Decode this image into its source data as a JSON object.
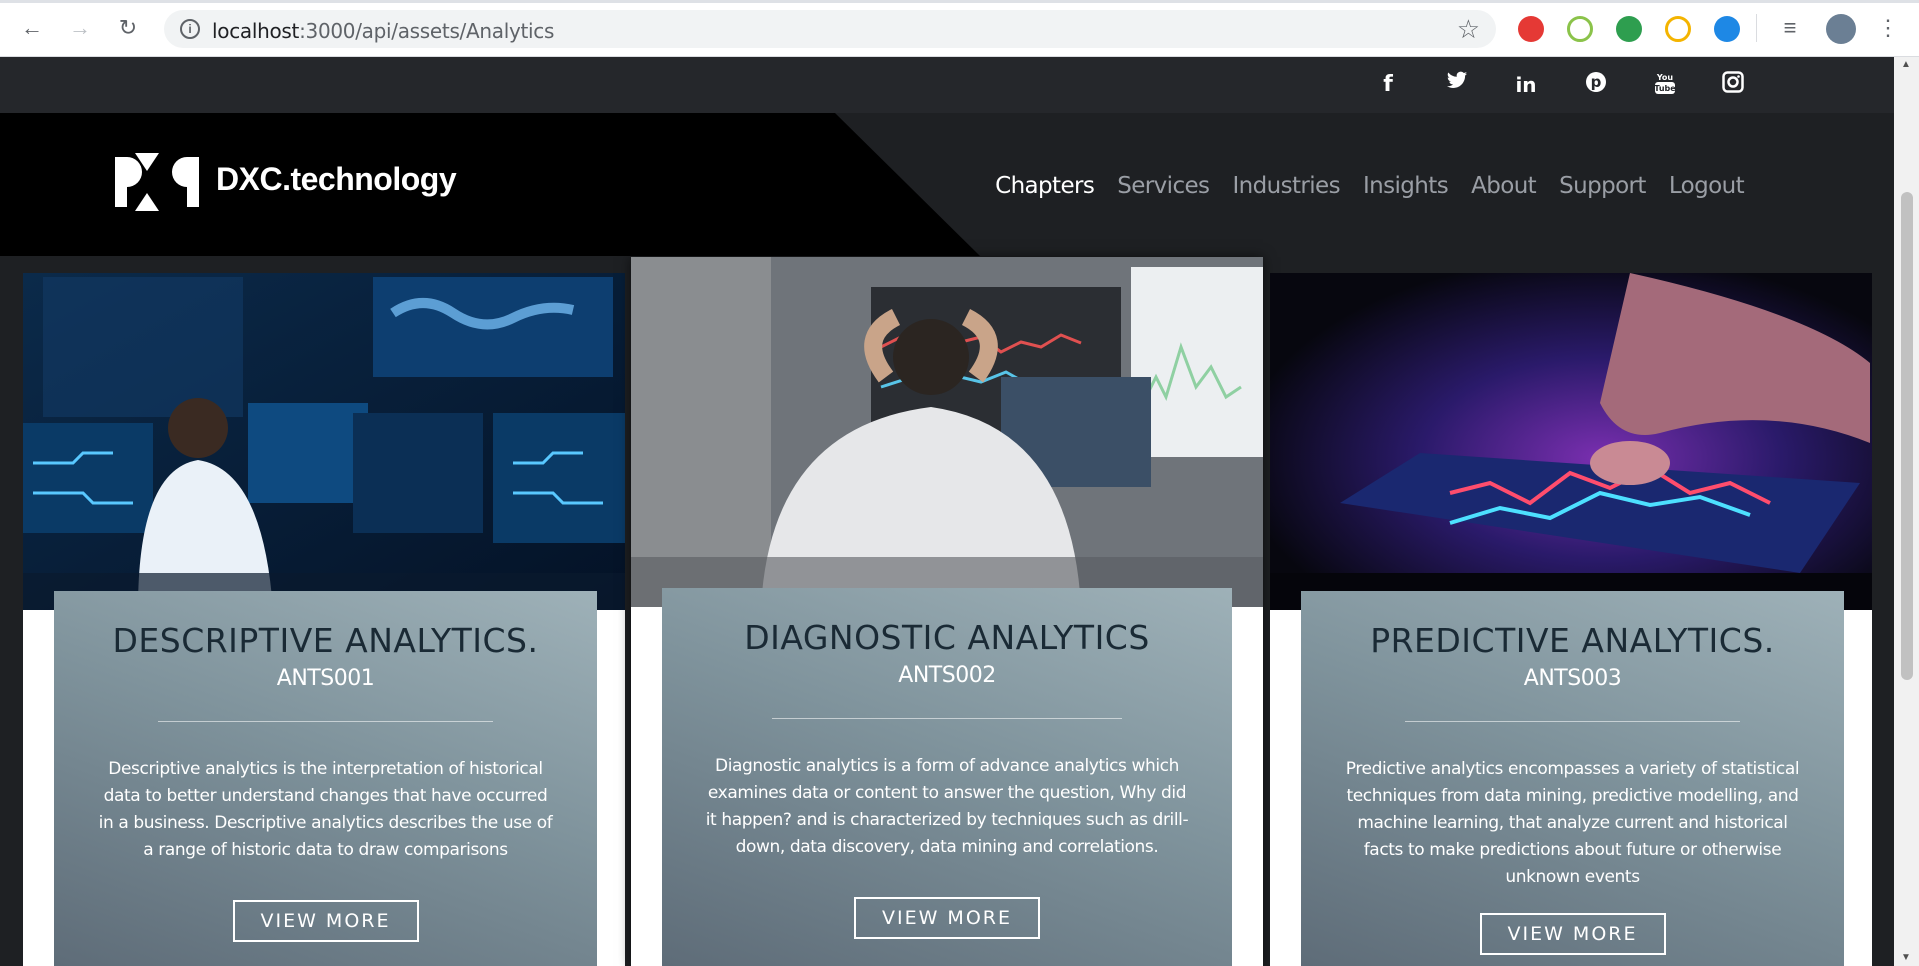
{
  "browser": {
    "url_host": "localhost",
    "url_rest": ":3000/api/assets/Analytics"
  },
  "social": [
    "f",
    "t",
    "in",
    "p",
    "yt",
    "ig"
  ],
  "brand": {
    "name": "DXC.technology"
  },
  "nav": {
    "items": [
      "Chapters",
      "Services",
      "Industries",
      "Insights",
      "About",
      "Support",
      "Logout"
    ],
    "active": "Chapters"
  },
  "cards": [
    {
      "title": "DESCRIPTIVE ANALYTICS.",
      "code": "ANTS001",
      "description": "Descriptive analytics is the interpretation of historical data to better understand changes that have occurred in a business. Descriptive analytics describes the use of a range of historic data to draw comparisons",
      "button": "VIEW MORE"
    },
    {
      "title": "DIAGNOSTIC ANALYTICS",
      "code": "ANTS002",
      "description": "Diagnostic analytics is a form of advance analytics which examines data or content to answer the question, Why did it happen? and is characterized by techniques such as drill-down, data discovery, data mining and correlations.",
      "button": "VIEW MORE"
    },
    {
      "title": "PREDICTIVE ANALYTICS.",
      "code": "ANTS003",
      "description": "Predictive analytics encompasses a variety of statistical techniques from data mining, predictive modelling, and machine learning, that analyze current and historical facts to make predictions about future or otherwise unknown events",
      "button": "VIEW MORE"
    }
  ],
  "colors": {
    "accent_panel": "#7f939c",
    "title_text": "#1a2a35",
    "nav_active": "#ffffff",
    "nav_inactive": "#9a9ea5"
  }
}
